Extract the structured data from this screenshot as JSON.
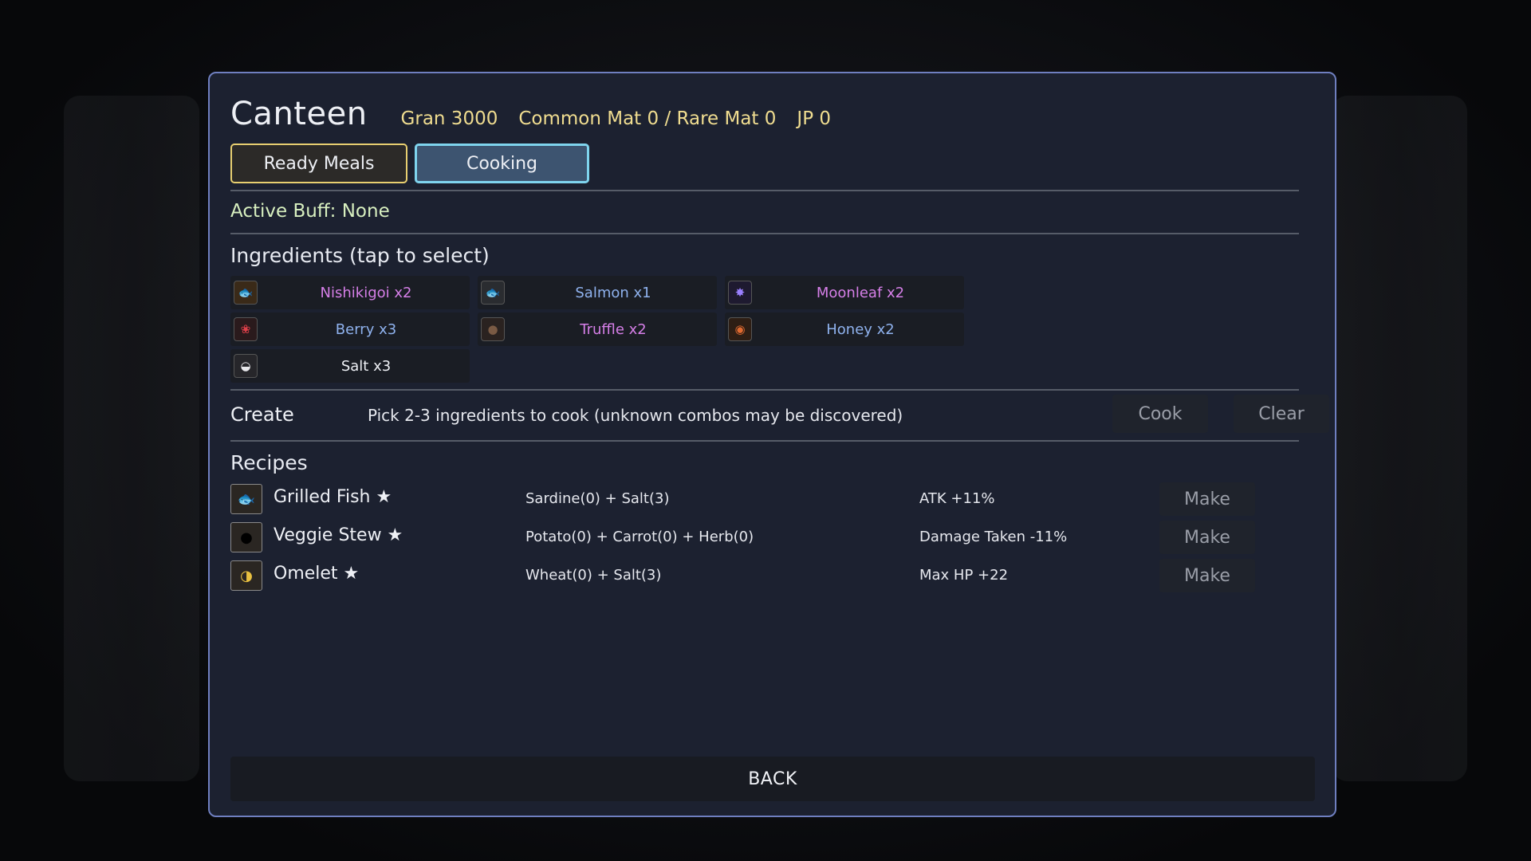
{
  "header": {
    "title": "Canteen",
    "gran": "Gran 3000",
    "mats": "Common Mat 0 / Rare Mat 0",
    "jp": "JP 0"
  },
  "tabs": {
    "ready_meals": "Ready Meals",
    "cooking": "Cooking"
  },
  "active_buff": "Active Buff: None",
  "ingredients": {
    "title": "Ingredients (tap to select)",
    "items": [
      {
        "label": "Nishikigoi x2",
        "color": "#d67fe8",
        "icon": "koi-icon"
      },
      {
        "label": "Salmon x1",
        "color": "#8fb2ee",
        "icon": "fish-icon"
      },
      {
        "label": "Moonleaf x2",
        "color": "#d67fe8",
        "icon": "moonleaf-icon"
      },
      {
        "label": "Berry x3",
        "color": "#8fb2ee",
        "icon": "berry-icon"
      },
      {
        "label": "Truffle x2",
        "color": "#d67fe8",
        "icon": "truffle-icon"
      },
      {
        "label": "Honey x2",
        "color": "#8fb2ee",
        "icon": "honey-icon"
      },
      {
        "label": "Salt x3",
        "color": "#eef0f5",
        "icon": "salt-icon"
      }
    ]
  },
  "create": {
    "label": "Create",
    "hint": "Pick 2-3 ingredients to cook (unknown combos may be discovered)",
    "cook": "Cook",
    "clear": "Clear"
  },
  "recipes": {
    "title": "Recipes",
    "items": [
      {
        "name": "Grilled Fish ★",
        "formula": "Sardine(0) + Salt(3)",
        "effect": "ATK +11%",
        "make": "Make",
        "icon": "grilled-fish-icon"
      },
      {
        "name": "Veggie Stew ★",
        "formula": "Potato(0) + Carrot(0) + Herb(0)",
        "effect": "Damage Taken -11%",
        "make": "Make",
        "icon": "stew-icon"
      },
      {
        "name": "Omelet ★",
        "formula": "Wheat(0) + Salt(3)",
        "effect": "Max HP +22",
        "make": "Make",
        "icon": "omelet-icon"
      }
    ]
  },
  "back_label": "BACK"
}
